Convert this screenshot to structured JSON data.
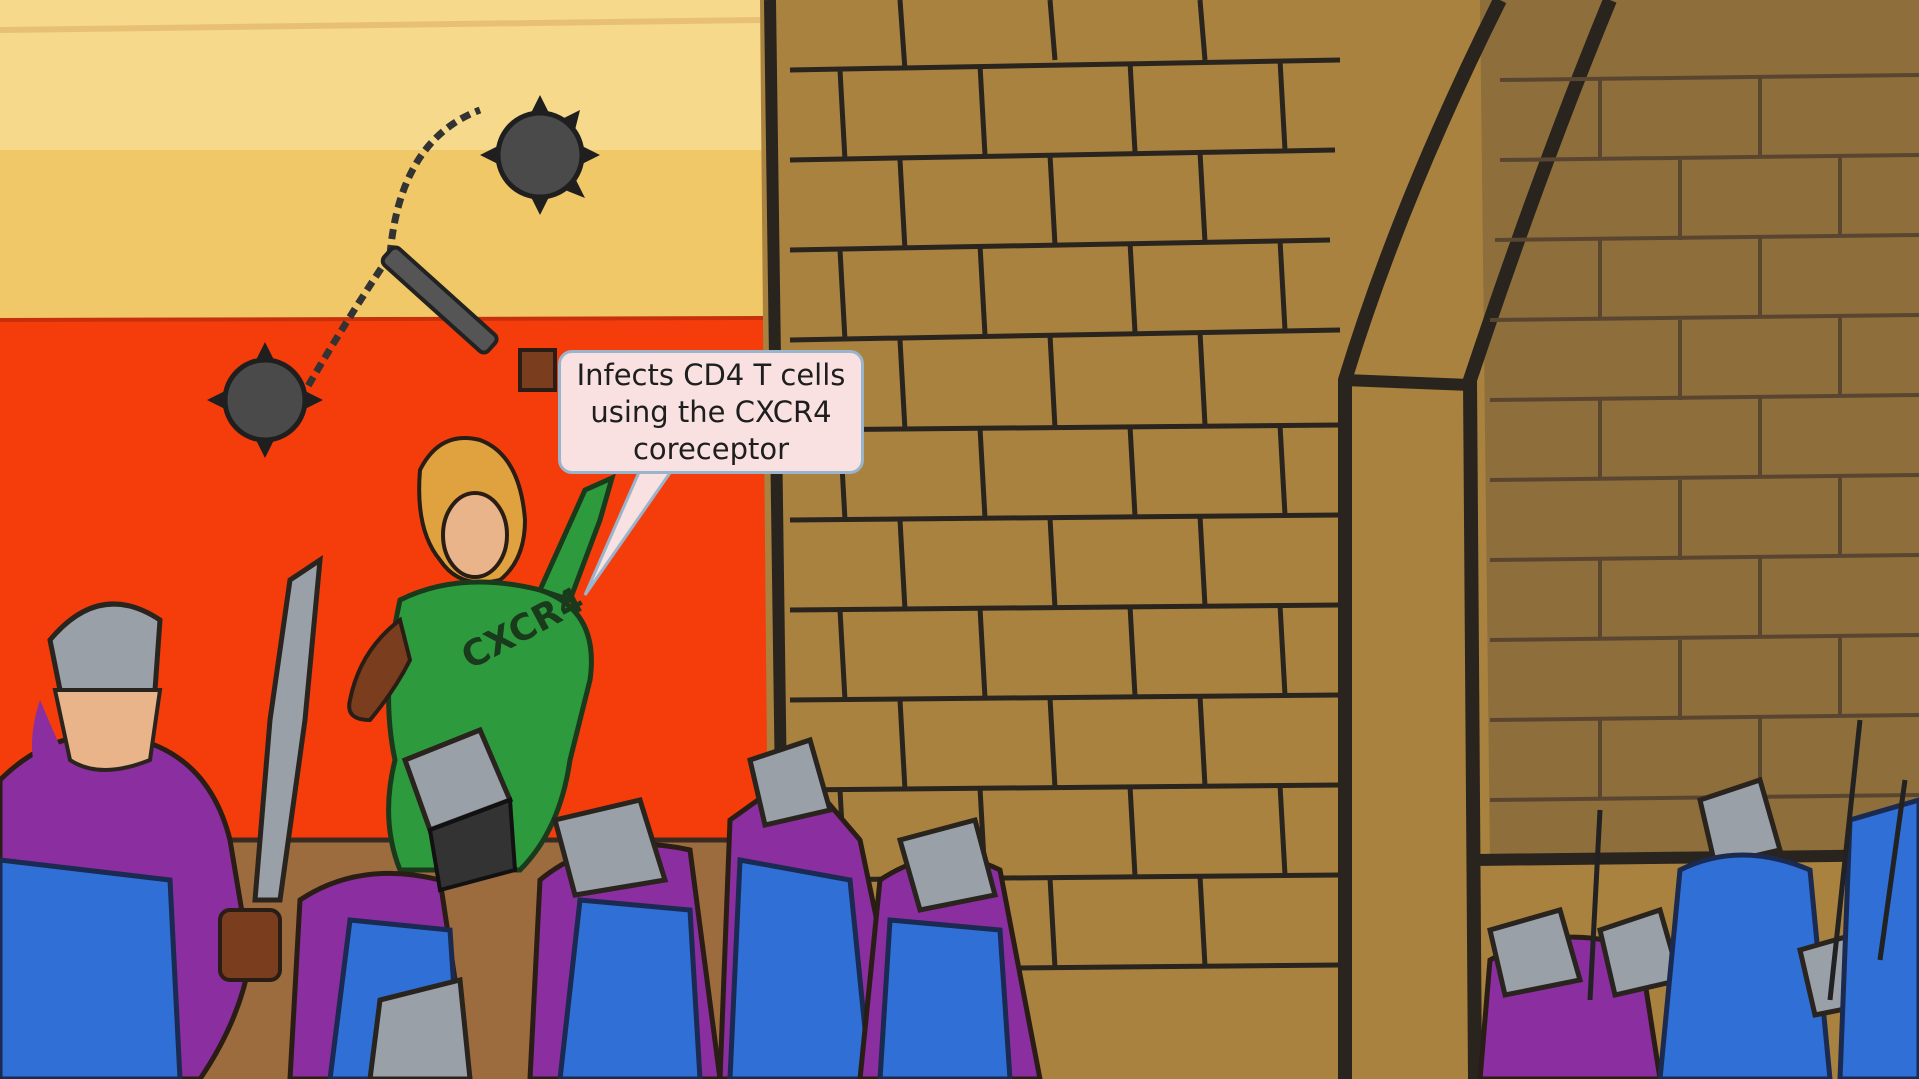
{
  "scene": {
    "description_icons": [
      "flail-icon",
      "sword-icon",
      "castle-tower-icon",
      "soldier-icon"
    ]
  },
  "callout": {
    "lines": [
      "Infects CD4 T cells",
      "using the CXCR4",
      "coreceptor"
    ]
  },
  "shirt_label": "CXCR4",
  "colors": {
    "sky_top": "#f6d98a",
    "sky_band": "#f0c868",
    "red_wall": "#f53d0c",
    "stone": "#a9823f",
    "stone_dark": "#8e6e3a",
    "shirt": "#2e9a3e",
    "helmet": "#9aa0a8",
    "purple": "#8a2ea0",
    "blue": "#2f6fd6"
  }
}
